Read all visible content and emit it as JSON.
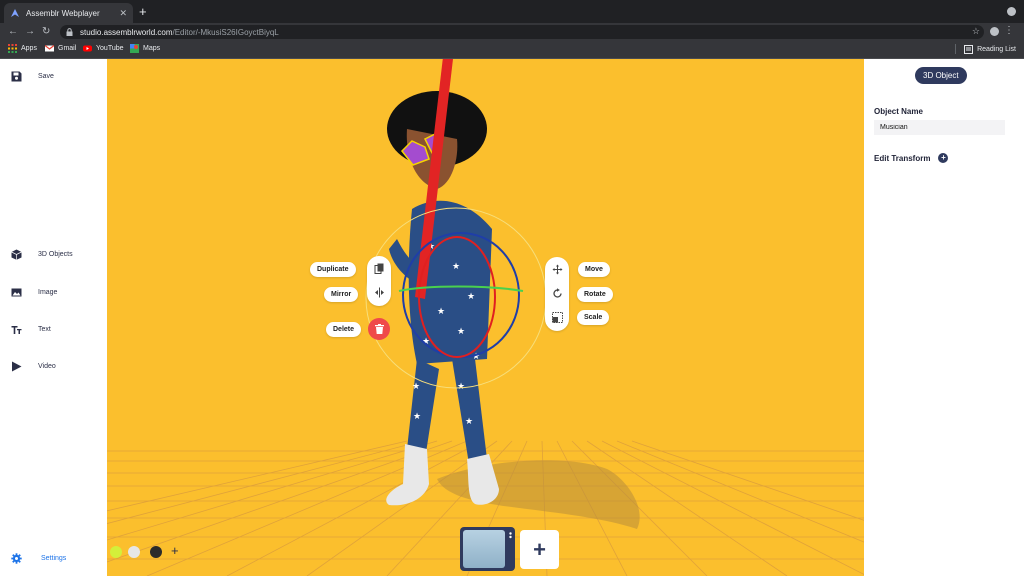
{
  "browser": {
    "tab_title": "Assemblr Webplayer",
    "url_host": "studio.assemblrworld.com",
    "url_path": "/Editor/-MkusiS26IGoyctBiyqL",
    "bookmarks": [
      "Apps",
      "Gmail",
      "YouTube",
      "Maps"
    ],
    "reading_list": "Reading List"
  },
  "sidebar": {
    "save": "Save",
    "objects": "3D Objects",
    "image": "Image",
    "text": "Text",
    "video": "Video",
    "settings": "Settings"
  },
  "context_menu": {
    "duplicate": "Duplicate",
    "mirror": "Mirror",
    "delete": "Delete",
    "move": "Move",
    "rotate": "Rotate",
    "scale": "Scale"
  },
  "panel": {
    "badge": "3D Object",
    "object_name_label": "Object Name",
    "object_name_value": "Musician",
    "edit_transform": "Edit Transform"
  },
  "colors": {
    "viewport_bg": "#fbbf2d",
    "accent": "#2f3a5e",
    "delete": "#ef4a4a",
    "swatches": [
      "#d4ef3a",
      "#e6e6e6",
      "#2b2b2b"
    ]
  }
}
